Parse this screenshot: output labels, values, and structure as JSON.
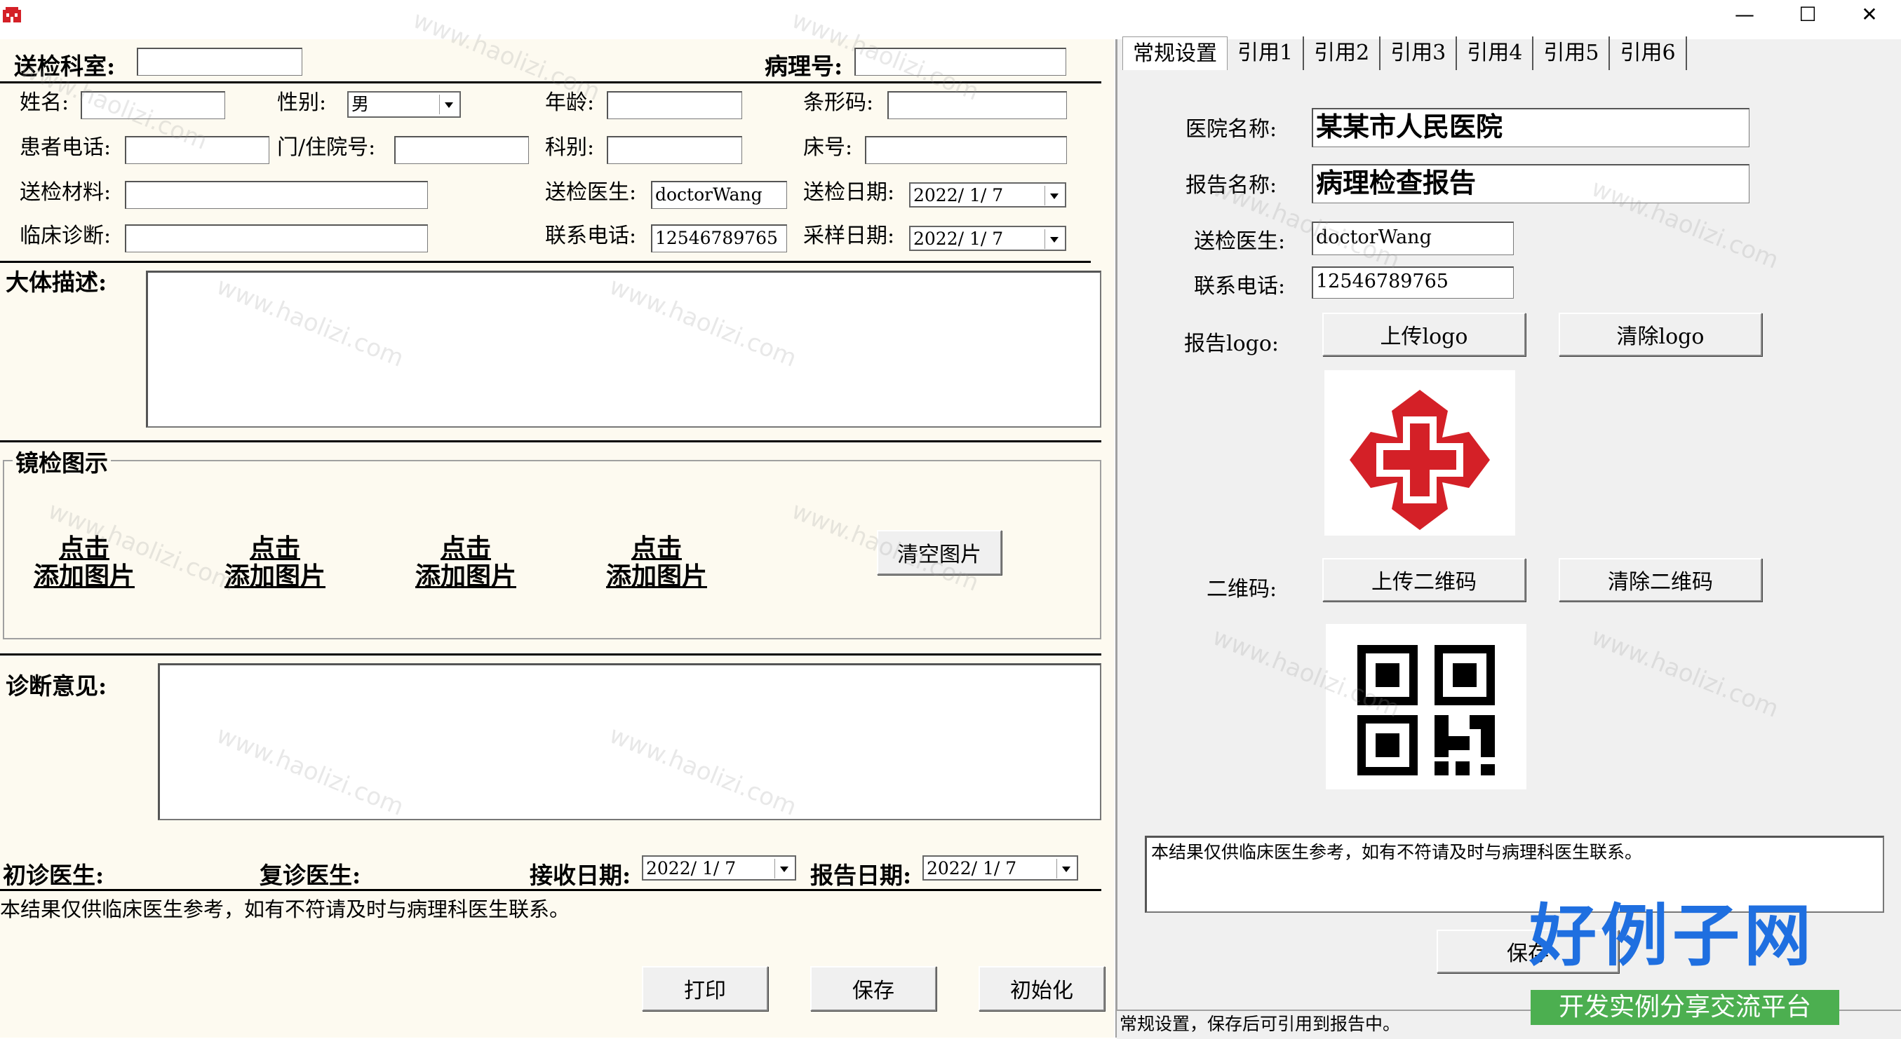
{
  "window": {
    "minimize": "—",
    "maximize": "☐",
    "close": "✕"
  },
  "report": {
    "dept_label": "送检科室:",
    "dept_value": "",
    "pathology_no_label": "病理号:",
    "pathology_no_value": "",
    "name_label": "姓名:",
    "gender_label": "性别:",
    "gender_value": "男",
    "age_label": "年龄:",
    "barcode_label": "条形码:",
    "phone_label": "患者电话:",
    "inpatient_label": "门/住院号:",
    "section_label": "科别:",
    "bed_label": "床号:",
    "material_label": "送检材料:",
    "doctor_label": "送检医生:",
    "doctor_value": "doctorWang",
    "send_date_label": "送检日期:",
    "send_date_value": "2022/ 1/ 7",
    "clinical_label": "临床诊断:",
    "contact_label": "联系电话:",
    "contact_value": "12546789765",
    "sample_date_label": "采样日期:",
    "sample_date_value": "2022/ 1/ 7",
    "gross_label": "大体描述:",
    "micro_label": "镜检图示",
    "add_pic": [
      "点击",
      "添加图片"
    ],
    "clear_pics": "清空图片",
    "diagnosis_label": "诊断意见:",
    "first_doc_label": "初诊医生:",
    "review_doc_label": "复诊医生:",
    "receive_date_label": "接收日期:",
    "receive_date_value": "2022/ 1/ 7",
    "report_date_label": "报告日期:",
    "report_date_value": "2022/ 1/ 7",
    "footer_note": "本结果仅供临床医生参考，如有不符请及时与病理科医生联系。",
    "print": "打印",
    "save": "保存",
    "init": "初始化"
  },
  "settings": {
    "tabs": [
      "常规设置",
      "引用1",
      "引用2",
      "引用3",
      "引用4",
      "引用5",
      "引用6"
    ],
    "hospital_label": "医院名称:",
    "hospital_value": "某某市人民医院",
    "report_name_label": "报告名称:",
    "report_name_value": "病理检查报告",
    "doctor_label": "送检医生:",
    "doctor_value": "doctorWang",
    "contact_label": "联系电话:",
    "contact_value": "12546789765",
    "logo_label": "报告logo:",
    "upload_logo": "上传logo",
    "clear_logo": "清除logo",
    "qr_label": "二维码:",
    "upload_qr": "上传二维码",
    "clear_qr": "清除二维码",
    "note": "本结果仅供临床医生参考，如有不符请及时与病理科医生联系。",
    "save": "保存",
    "status": "常规设置，保存后可引用到报告中。"
  },
  "branding": {
    "main": "好例子网",
    "sub": "开发实例分享交流平台"
  },
  "watermark": "www.haolizi.com",
  "colors": {
    "logo_red": "#d42027",
    "brand_blue": "#1f6fe0",
    "brand_green": "#4caf50"
  }
}
